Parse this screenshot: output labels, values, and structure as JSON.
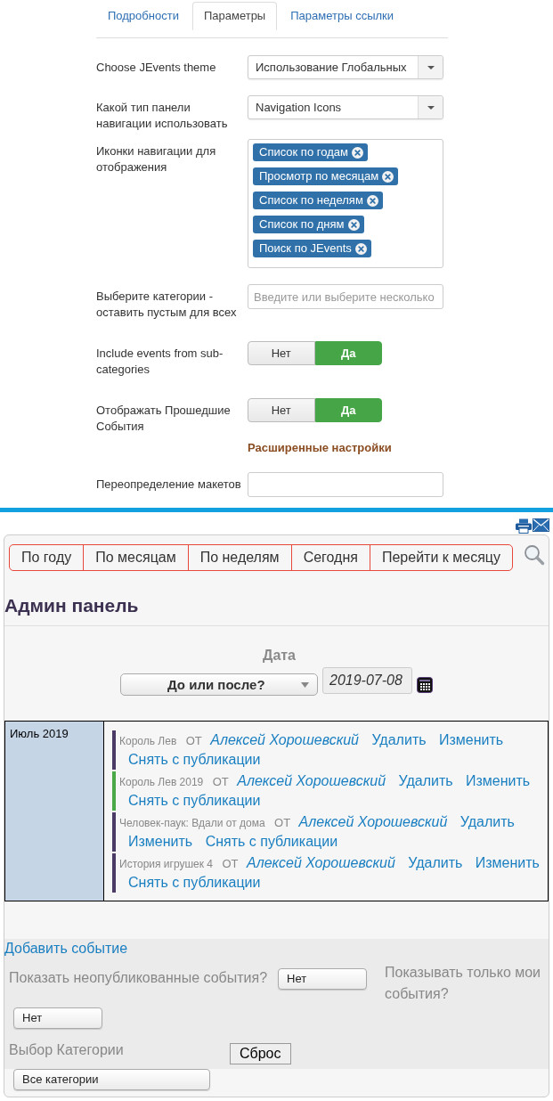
{
  "settings_tabs": [
    {
      "label": "Подробности",
      "selected": false
    },
    {
      "label": "Параметры",
      "selected": true
    },
    {
      "label": "Параметры ссылки",
      "selected": false
    }
  ],
  "settings": [
    {
      "kind": "select",
      "label": "Choose JEvents theme",
      "value": "Использование Глобальных"
    },
    {
      "kind": "select",
      "label": "Какой тип панели навигации использовать",
      "value": "Navigation Icons"
    },
    {
      "kind": "tags",
      "label": "Иконки навигации для отображения",
      "tags": [
        "Список по годам",
        "Просмотр по месяцам",
        "Список по неделям",
        "Список по дням",
        "Поиск по JEvents"
      ]
    },
    {
      "kind": "text",
      "label": "Выберите категории - оставить пустым для всех",
      "placeholder": "Введите или выберите несколько"
    },
    {
      "kind": "toggle",
      "label": "Include events from sub-categories",
      "options": [
        {
          "label": "Нет",
          "selected": false
        },
        {
          "label": "Да",
          "selected": true
        }
      ]
    },
    {
      "kind": "toggle",
      "label": "Отображать Прошедшие События",
      "options": [
        {
          "label": "Нет",
          "selected": false
        },
        {
          "label": "Да",
          "selected": true
        }
      ]
    },
    {
      "kind": "heading",
      "label": "Расширенные настройки"
    },
    {
      "kind": "text",
      "label": "Переопределение макетов"
    }
  ],
  "calendar": {
    "nav_buttons": [
      "По году",
      "По месяцам",
      "По неделям",
      "Сегодня",
      "Перейти к месяцу"
    ],
    "title": "Админ панель",
    "date_filter": {
      "label": "Дата",
      "mode": "До или после?",
      "date": "2019-07-08"
    },
    "month": "Июль 2019",
    "events": [
      {
        "title": "Король Лев",
        "by": "ОТ",
        "author": "Алексей Хорошевский",
        "color": "#4b3a66",
        "actions": [
          "Удалить",
          "Изменить",
          "Снять с публикации"
        ]
      },
      {
        "title": "Король Лев 2019",
        "by": "ОТ",
        "author": "Алексей Хорошевский",
        "color": "#4aa846",
        "actions": [
          "Удалить",
          "Изменить",
          "Снять с публикации"
        ]
      },
      {
        "title": "Человек-паук: Вдали от дома",
        "by": "ОТ",
        "author": "Алексей Хорошевский",
        "color": "#4b3a66",
        "actions": [
          "Удалить",
          "Изменить",
          "Снять с публикации"
        ]
      },
      {
        "title": "История игрушек 4",
        "by": "ОТ",
        "author": "Алексей Хорошевский",
        "color": "#4b3a66",
        "actions": [
          "Удалить",
          "Изменить",
          "Снять с публикации"
        ]
      }
    ],
    "add_event": "Добавить событие",
    "filters": {
      "unpublished": {
        "label": "Показать неопубликованные события?",
        "value": "Нет"
      },
      "mine": {
        "label": "Показывать только мои события?",
        "value": "Нет"
      },
      "category": {
        "label": "Выбор Категории",
        "value": "Все категории"
      },
      "reset": "Сброс"
    }
  }
}
